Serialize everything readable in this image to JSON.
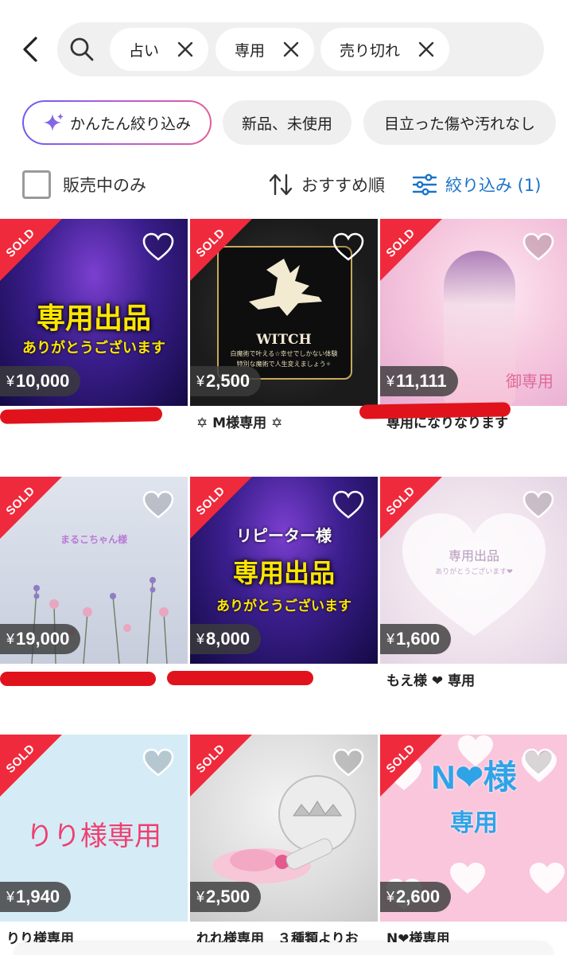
{
  "search": {
    "chips": [
      {
        "label": "占い"
      },
      {
        "label": "専用"
      },
      {
        "label": "売り切れ"
      }
    ]
  },
  "filters": {
    "ai_label": "かんたん絞り込み",
    "condition_new": "新品、未使用",
    "condition_clean": "目立った傷や汚れなし"
  },
  "options": {
    "on_sale_only": "販売中のみ",
    "sort_label": "おすすめ順",
    "filter_label": "絞り込み (1)"
  },
  "colors": {
    "sold_badge": "#ef2a3c",
    "accent_blue": "#1a73c8",
    "redaction": "#e0131d"
  },
  "items": [
    {
      "badge": "SOLD",
      "price": "10,000",
      "title": "",
      "art": [
        "専用出品",
        "ありがとうございます"
      ]
    },
    {
      "badge": "SOLD",
      "price": "2,500",
      "title": "✡ M様専用 ✡",
      "art": [
        "WITCH",
        "白魔術で叶える☆幸せでしかない体験",
        "特別な魔術で人生変えましょう✧"
      ]
    },
    {
      "badge": "SOLD",
      "price": "11,111",
      "title": "専用になりなります",
      "art": [
        "御専用"
      ]
    },
    {
      "badge": "SOLD",
      "price": "19,000",
      "title": "",
      "art": [
        "まるこちゃん様"
      ]
    },
    {
      "badge": "SOLD",
      "price": "8,000",
      "title": "",
      "art": [
        "リピーター様",
        "専用出品",
        "ありがとうございます"
      ]
    },
    {
      "badge": "SOLD",
      "price": "1,600",
      "title": "もえ様 ❤ 専用",
      "art": [
        "専用出品",
        "ありがとうございます❤"
      ]
    },
    {
      "badge": "SOLD",
      "price": "1,940",
      "title": "りり様専用",
      "art": [
        "りり様専用"
      ]
    },
    {
      "badge": "SOLD",
      "price": "2,500",
      "title": "れれ様専用　３種類よりお",
      "art": []
    },
    {
      "badge": "SOLD",
      "price": "2,600",
      "title": "N❤様専用",
      "art": [
        "N❤様",
        "専用"
      ]
    }
  ],
  "currency": "¥"
}
